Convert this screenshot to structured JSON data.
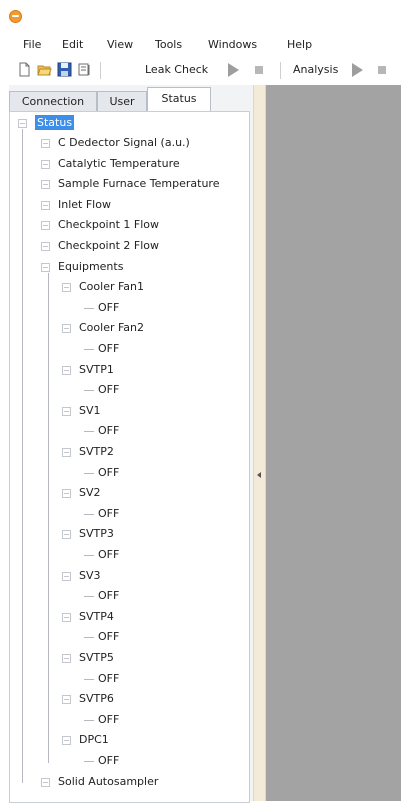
{
  "menu": [
    "File",
    "Edit",
    "View",
    "Tools",
    "Windows",
    "Help"
  ],
  "toolbar": {
    "leak_check": "Leak Check",
    "analysis": "Analysis",
    "icons": [
      "new-file-icon",
      "open-folder-icon",
      "save-icon",
      "print-preview-icon"
    ]
  },
  "tabs": [
    "Connection",
    "User",
    "Status"
  ],
  "active_tab": "Status",
  "tree": {
    "root": "Status",
    "items": [
      "C Dedector Signal (a.u.)",
      "Catalytic Temperature",
      "Sample Furnace Temperature",
      "Inlet Flow",
      "Checkpoint 1 Flow",
      "Checkpoint 2 Flow",
      "Equipments"
    ],
    "equipments": [
      {
        "name": "Cooler Fan1",
        "state": "OFF"
      },
      {
        "name": "Cooler Fan2",
        "state": "OFF"
      },
      {
        "name": "SVTP1",
        "state": "OFF"
      },
      {
        "name": "SV1",
        "state": "OFF"
      },
      {
        "name": "SVTP2",
        "state": "OFF"
      },
      {
        "name": "SV2",
        "state": "OFF"
      },
      {
        "name": "SVTP3",
        "state": "OFF"
      },
      {
        "name": "SV3",
        "state": "OFF"
      },
      {
        "name": "SVTP4",
        "state": "OFF"
      },
      {
        "name": "SVTP5",
        "state": "OFF"
      },
      {
        "name": "SVTP6",
        "state": "OFF"
      },
      {
        "name": "DPC1",
        "state": "OFF"
      }
    ],
    "last_item": "Solid Autosampler"
  },
  "colors": {
    "selection": "#3d8ee8",
    "panel_bg": "#f2f3f5",
    "right_area": "#a3a3a3",
    "splitter": "#f4ead8",
    "app_icon": "#f39a2e"
  }
}
